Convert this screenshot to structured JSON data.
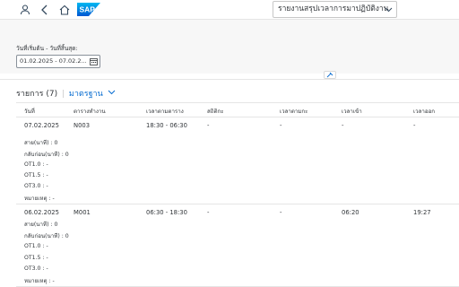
{
  "shell": {
    "logo_text": "SAP",
    "app_title": "รายงานสรุปเวลาการมาปฏิบัติงาน"
  },
  "filter": {
    "date_label": "วันที่เริ่มต้น - วันที่สิ้นสุด:",
    "date_value": "01.02.2025 - 07.02.2..."
  },
  "table": {
    "title": "รายการ (7)",
    "variant": "มาตรฐาน",
    "columns": [
      "วันที่",
      "ตารางทำงาน",
      "เวลาตามตาราง",
      "สถิติกะ",
      "เวลาตามกะ",
      "เวลาเข้า",
      "เวลาออก"
    ],
    "rows": [
      {
        "date": "07.02.2025",
        "schedule": "N003",
        "time": "18:30 - 06:30",
        "shift_status": "-",
        "shift_time": "-",
        "in": "-",
        "out": "-",
        "late_label": "สาย(นาที) :",
        "late": "0",
        "early_label": "กลับก่อน(นาที) :",
        "early": "0",
        "ot10_label": "OT1.0 :",
        "ot10": "-",
        "ot15_label": "OT1.5 :",
        "ot15": "-",
        "ot30_label": "OT3.0 :",
        "ot30": "-",
        "note_label": "หมายเหตุ :",
        "note": "-"
      },
      {
        "date": "06.02.2025",
        "schedule": "M001",
        "time": "06:30 - 18:30",
        "shift_status": "-",
        "shift_time": "-",
        "in": "06:20",
        "out": "19:27",
        "late_label": "สาย(นาที) :",
        "late": "0",
        "early_label": "กลับก่อน(นาที) :",
        "early": "0",
        "ot10_label": "OT1.0 :",
        "ot10": "-",
        "ot15_label": "OT1.5 :",
        "ot15": "-",
        "ot30_label": "OT3.0 :",
        "ot30": "-",
        "note_label": "หมายเหตุ :",
        "note": "-"
      }
    ]
  },
  "colors": {
    "accent": "#0a6ed1",
    "sap_blue": "#008fd3",
    "shell_icon": "#354a5f"
  }
}
